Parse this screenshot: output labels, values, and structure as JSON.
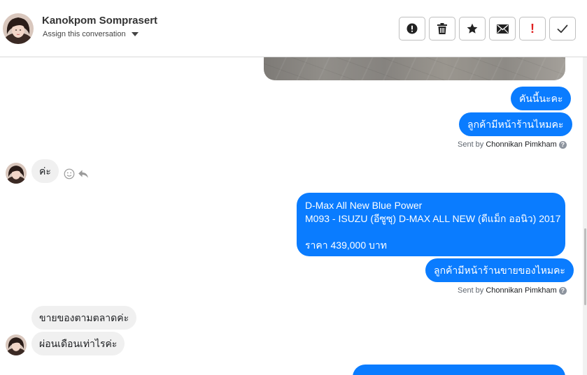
{
  "header": {
    "contact_name": "Kanokpom Somprasert",
    "assign_label": "Assign this conversation"
  },
  "actions": [
    {
      "name": "report-button",
      "icon": "exclamation-circle-icon"
    },
    {
      "name": "delete-button",
      "icon": "trash-icon"
    },
    {
      "name": "star-button",
      "icon": "star-icon"
    },
    {
      "name": "mark-unread-button",
      "icon": "envelope-icon"
    },
    {
      "name": "important-button",
      "icon": "exclamation-icon",
      "label": "!"
    },
    {
      "name": "done-button",
      "icon": "check-icon"
    }
  ],
  "messages": {
    "m1": "คันนี้นะคะ",
    "m2": "ลูกค้ามีหน้าร้านไหมคะ",
    "sent_by_prefix": "Sent by",
    "sent_by_name": "Chonnikan Pimkham",
    "in1": "ค่ะ",
    "card_line1": "D-Max All New Blue Power",
    "card_line2": "M093 - ISUZU (อีซูซุ) D-MAX ALL NEW (ดีแม็ก ออนิว) 2017",
    "card_line3": "ราคา 439,000 บาท",
    "m3": "ลูกค้ามีหน้าร้านขายของไหมคะ",
    "in2": "ขายของตามตลาดค่ะ",
    "in3": "ผ่อนเดือนเท่าไรค่ะ"
  },
  "colors": {
    "outgoing": "#0a7cff",
    "incoming": "#f0f0f0",
    "important": "#e02020"
  }
}
